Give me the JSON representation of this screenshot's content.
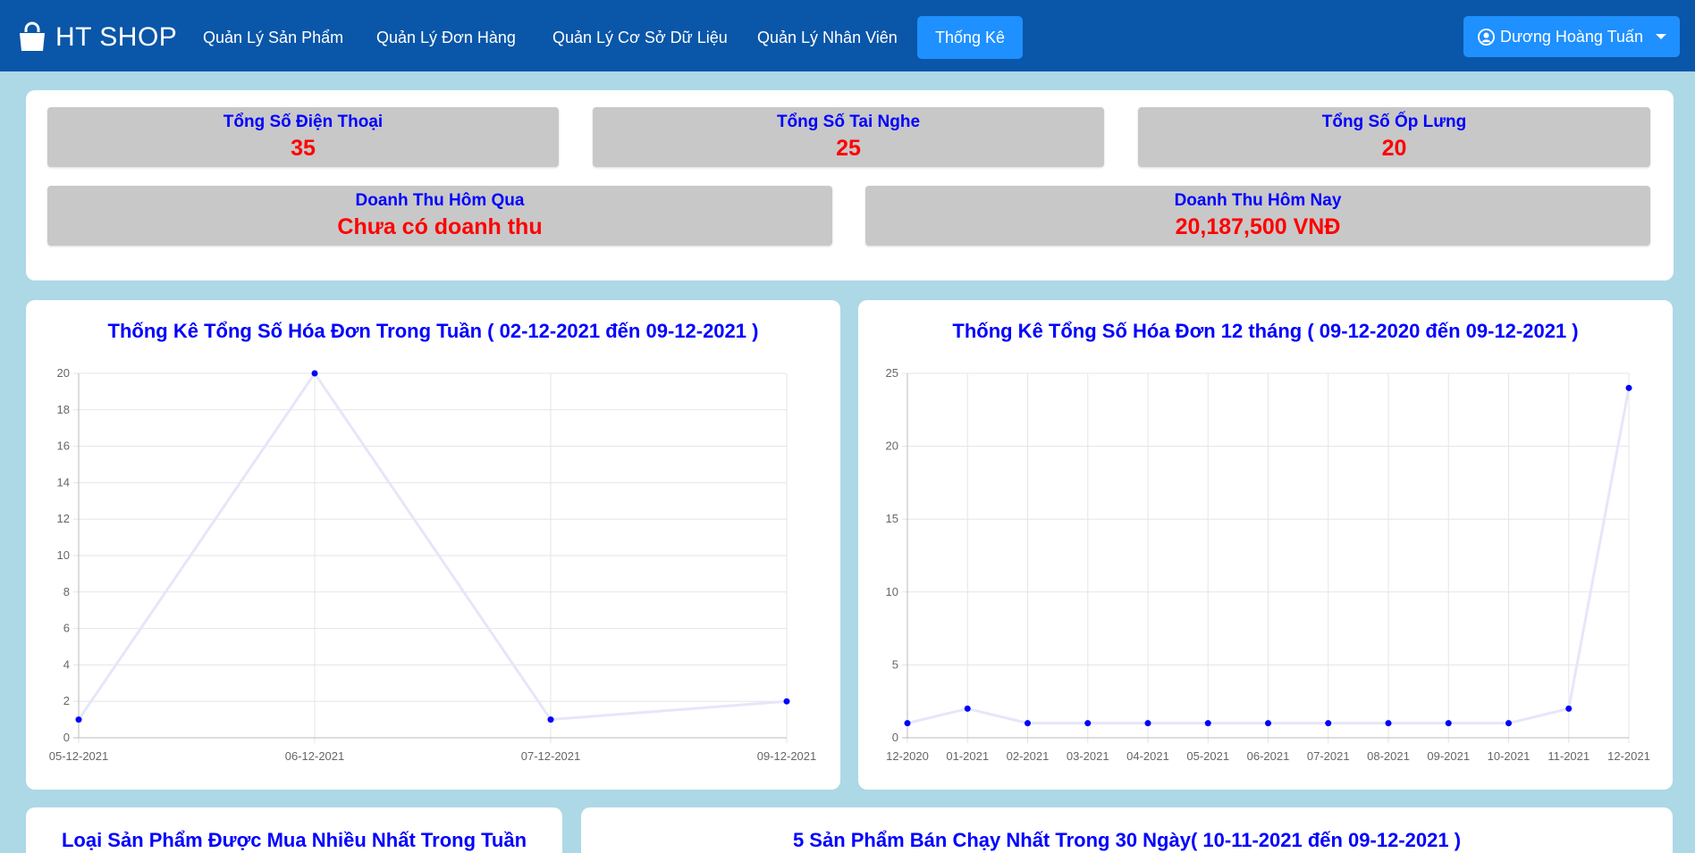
{
  "app": {
    "brand": "HT SHOP"
  },
  "nav": {
    "items": [
      {
        "label": "Quản Lý Sản Phẩm"
      },
      {
        "label": "Quản Lý Đơn Hàng"
      },
      {
        "label": "Quản Lý Cơ Sở Dữ Liệu"
      },
      {
        "label": "Quản Lý Nhân Viên"
      },
      {
        "label": "Thống Kê"
      }
    ],
    "user": "Dương Hoàng Tuấn"
  },
  "stats": {
    "phones": {
      "label": "Tổng Số Điện Thoại",
      "value": "35"
    },
    "headphones": {
      "label": "Tổng Số Tai Nghe",
      "value": "25"
    },
    "cases": {
      "label": "Tổng Số Ốp Lưng",
      "value": "20"
    },
    "yesterday": {
      "label": "Doanh Thu Hôm Qua",
      "value": "Chưa có doanh thu"
    },
    "today": {
      "label": "Doanh Thu Hôm Nay",
      "value": "20,187,500 VNĐ"
    }
  },
  "sections": {
    "top_category_title": "Loại Sản Phẩm Được Mua Nhiều Nhất Trong Tuần",
    "top5_title": "5 Sản Phẩm Bán Chạy Nhất Trong 30 Ngày( 10-11-2021 đến 09-12-2021 )"
  },
  "colors": {
    "navbar": "#0a56a8",
    "accent": "#1e90ff",
    "background": "#add8e6",
    "label": "#0000ff",
    "value": "#ff0000",
    "point": "#0000ff",
    "line": "#e6e6fa"
  },
  "chart_data": [
    {
      "type": "line",
      "title": "Thống Kê Tổng Số Hóa Đơn Trong Tuần ( 02-12-2021 đến 09-12-2021 )",
      "categories": [
        "05-12-2021",
        "06-12-2021",
        "07-12-2021",
        "09-12-2021"
      ],
      "values": [
        1,
        20,
        1,
        2
      ],
      "ylim": [
        0,
        20
      ],
      "yticks": [
        0,
        2,
        4,
        6,
        8,
        10,
        12,
        14,
        16,
        18,
        20
      ],
      "grid": true,
      "legend": "none"
    },
    {
      "type": "line",
      "title": "Thống Kê Tổng Số Hóa Đơn 12 tháng ( 09-12-2020 đến 09-12-2021 )",
      "categories": [
        "12-2020",
        "01-2021",
        "02-2021",
        "03-2021",
        "04-2021",
        "05-2021",
        "06-2021",
        "07-2021",
        "08-2021",
        "09-2021",
        "10-2021",
        "11-2021",
        "12-2021"
      ],
      "values": [
        1,
        2,
        1,
        1,
        1,
        1,
        1,
        1,
        1,
        1,
        1,
        2,
        24
      ],
      "ylim": [
        0,
        25
      ],
      "yticks": [
        0,
        5,
        10,
        15,
        20,
        25
      ],
      "grid": true,
      "legend": "none"
    }
  ]
}
